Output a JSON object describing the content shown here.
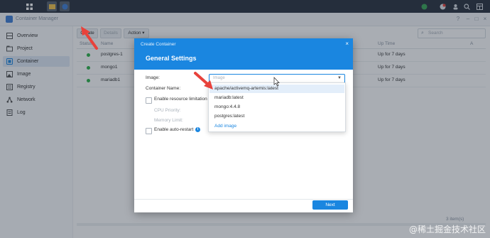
{
  "window": {
    "title": "Container Manager"
  },
  "toolbar": {
    "create_label": "Create",
    "details_label": "Details",
    "action_label": "Action ▾",
    "search_placeholder": "Search"
  },
  "sidebar": {
    "items": [
      {
        "label": "Overview",
        "icon": "overview-icon"
      },
      {
        "label": "Project",
        "icon": "project-icon"
      },
      {
        "label": "Container",
        "icon": "container-icon",
        "active": true
      },
      {
        "label": "Image",
        "icon": "image-icon"
      },
      {
        "label": "Registry",
        "icon": "registry-icon"
      },
      {
        "label": "Network",
        "icon": "network-icon"
      },
      {
        "label": "Log",
        "icon": "log-icon"
      }
    ]
  },
  "table": {
    "columns": [
      "Status",
      "Name",
      "Up Time",
      "A"
    ],
    "rows": [
      {
        "name": "postgres-1",
        "uptime": "Up for 7 days",
        "status": "running"
      },
      {
        "name": "mongo1",
        "uptime": "Up for 7 days",
        "status": "running"
      },
      {
        "name": "mariadb1",
        "uptime": "Up for 7 days",
        "status": "running"
      }
    ],
    "footer_count": "3 item(s)"
  },
  "dialog": {
    "caption": "Create Container",
    "title": "General Settings",
    "image_label": "Image:",
    "image_placeholder": "Image",
    "container_name_label": "Container Name:",
    "resource_limitation_label": "Enable resource limitation",
    "cpu_priority_label": "CPU Priority:",
    "memory_limit_label": "Memory Limit:",
    "auto_restart_label": "Enable auto-restart",
    "next_label": "Next",
    "dropdown": {
      "options": [
        "apache/activemq-artemis:latest",
        "mariadb:latest",
        "mongo:4.4.8",
        "postgres:latest"
      ],
      "add_image_label": "Add image"
    }
  },
  "watermark": "@稀土掘金技术社区",
  "colors": {
    "accent": "#1a86e0",
    "running": "#2db34a",
    "annotation": "#e8423b"
  }
}
